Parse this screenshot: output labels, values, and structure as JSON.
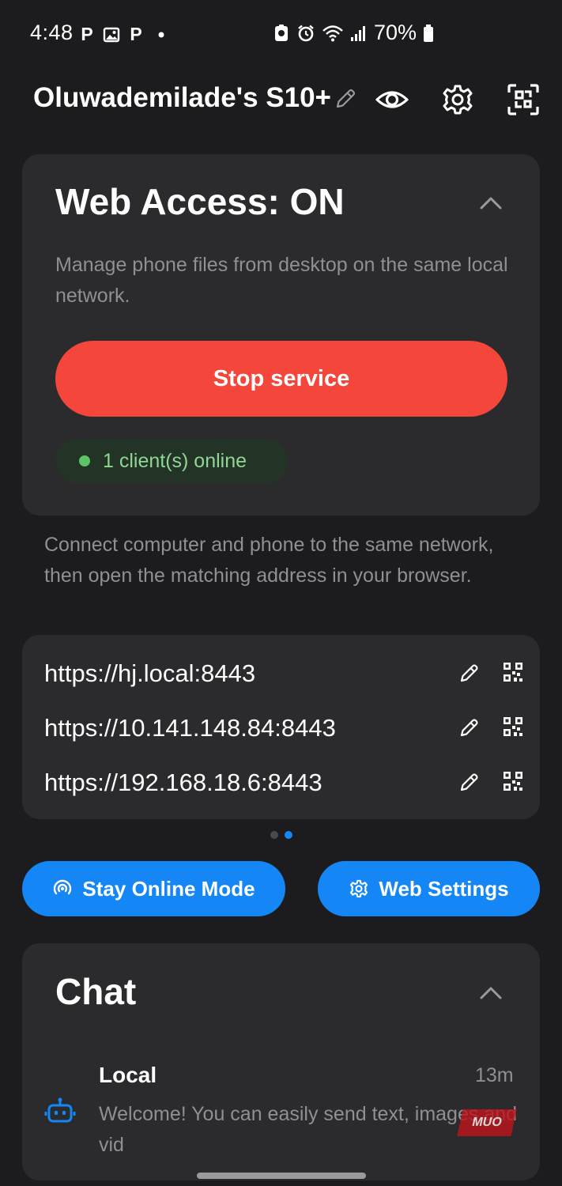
{
  "status_bar": {
    "time": "4:48",
    "left_icons": [
      "p-icon",
      "image-icon",
      "p-icon",
      "dot-icon"
    ],
    "right_icons": [
      "photo-scan-icon",
      "alarm-icon",
      "wifi-icon",
      "signal-icon"
    ],
    "battery_percent": "70%",
    "battery_icon": "battery-icon"
  },
  "header": {
    "device_name": "Oluwademilade's S10+",
    "actions": [
      "edit-icon",
      "eye-icon",
      "gear-icon",
      "scan-icon"
    ]
  },
  "web_access": {
    "title": "Web Access: ON",
    "description": "Manage phone files from desktop on the same local network.",
    "stop_button": "Stop service",
    "clients_online": "1 client(s) online"
  },
  "connect": {
    "instructions": "Connect computer and phone to the same network, then open the matching address in your browser.",
    "addresses": [
      {
        "url": "https://hj.local:8443"
      },
      {
        "url": "https://10.141.148.84:8443"
      },
      {
        "url": "https://192.168.18.6:8443"
      }
    ],
    "pager_active_index": 1
  },
  "actions": {
    "stay_online": "Stay Online Mode",
    "web_settings": "Web Settings"
  },
  "chat": {
    "title": "Chat",
    "items": [
      {
        "name": "Local",
        "time": "13m",
        "preview": "Welcome! You can easily send text, images and vid"
      }
    ]
  },
  "watermark": "MUO",
  "colors": {
    "background": "#1c1c1e",
    "card": "#2b2b2d",
    "danger": "#f5463b",
    "accent": "#1586f5",
    "online_green": "#5bc466",
    "muted_text": "#8f8f94"
  }
}
